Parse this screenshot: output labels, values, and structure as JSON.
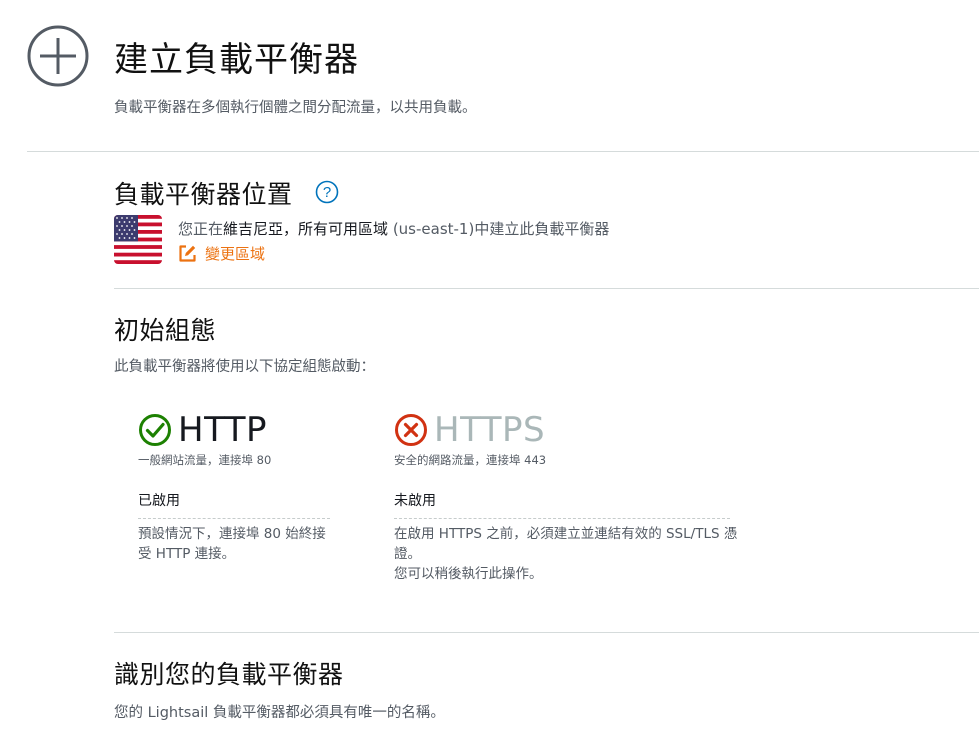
{
  "header": {
    "title": "建立負載平衡器",
    "description": "負載平衡器在多個執行個體之間分配流量，以共用負載。"
  },
  "location": {
    "title": "負載平衡器位置",
    "text_prefix": "您正在",
    "region_name": "維吉尼亞，所有可用區域",
    "region_code": "(us-east-1)",
    "text_suffix": "中建立此負載平衡器",
    "change_region_label": "變更區域",
    "flag_icon": "us-flag-icon"
  },
  "initial_config": {
    "title": "初始組態",
    "description": "此負載平衡器將使用以下協定組態啟動：",
    "protocols": [
      {
        "name": "HTTP",
        "subtitle": "一般網站流量，連接埠 80",
        "status": "已啟用",
        "detail": "預設情況下，連接埠 80 始終接受 HTTP 連接。",
        "icon": "check-circle-icon",
        "color": "#1d8102"
      },
      {
        "name": "HTTPS",
        "subtitle": "安全的網路流量，連接埠 443",
        "status": "未啟用",
        "detail_line1": "在啟用 HTTPS 之前，必須建立並連結有效的 SSL/TLS 憑證。",
        "detail_line2": "您可以稍後執行此操作。",
        "icon": "x-circle-icon",
        "color": "#d13212"
      }
    ]
  },
  "identify": {
    "title": "識別您的負載平衡器",
    "description": "您的 Lightsail 負載平衡器都必須具有唯一的名稱。"
  },
  "colors": {
    "accent_orange": "#ec7211",
    "help_blue": "#0073bb",
    "divider": "#d5dbdb"
  }
}
